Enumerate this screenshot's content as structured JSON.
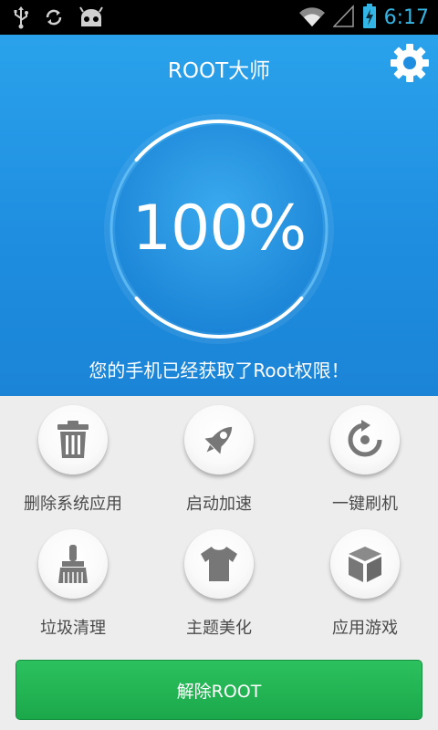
{
  "status_bar": {
    "time": "6:17",
    "left_icons": [
      "usb-icon",
      "sync-icon",
      "android-icon"
    ],
    "right_icons": [
      "wifi-icon",
      "signal-icon",
      "battery-charging-icon"
    ],
    "accent": "#33b5e5"
  },
  "header": {
    "title": "ROOT大师",
    "settings_icon": "gear-icon",
    "progress_percent": 100,
    "percent_label": "100%",
    "message": "您的手机已经获取了Root权限！"
  },
  "features": [
    {
      "label": "删除系统应用",
      "icon": "trash-icon"
    },
    {
      "label": "启动加速",
      "icon": "rocket-icon"
    },
    {
      "label": "一键刷机",
      "icon": "refresh-icon"
    },
    {
      "label": "垃圾清理",
      "icon": "brush-icon"
    },
    {
      "label": "主题美化",
      "icon": "tshirt-icon"
    },
    {
      "label": "应用游戏",
      "icon": "box-icon"
    }
  ],
  "action": {
    "unroot_label": "解除ROOT",
    "color": "#22b253"
  },
  "colors": {
    "hero_blue": "#1f8ee0",
    "background": "#ededed",
    "icon_gray": "#777777"
  }
}
